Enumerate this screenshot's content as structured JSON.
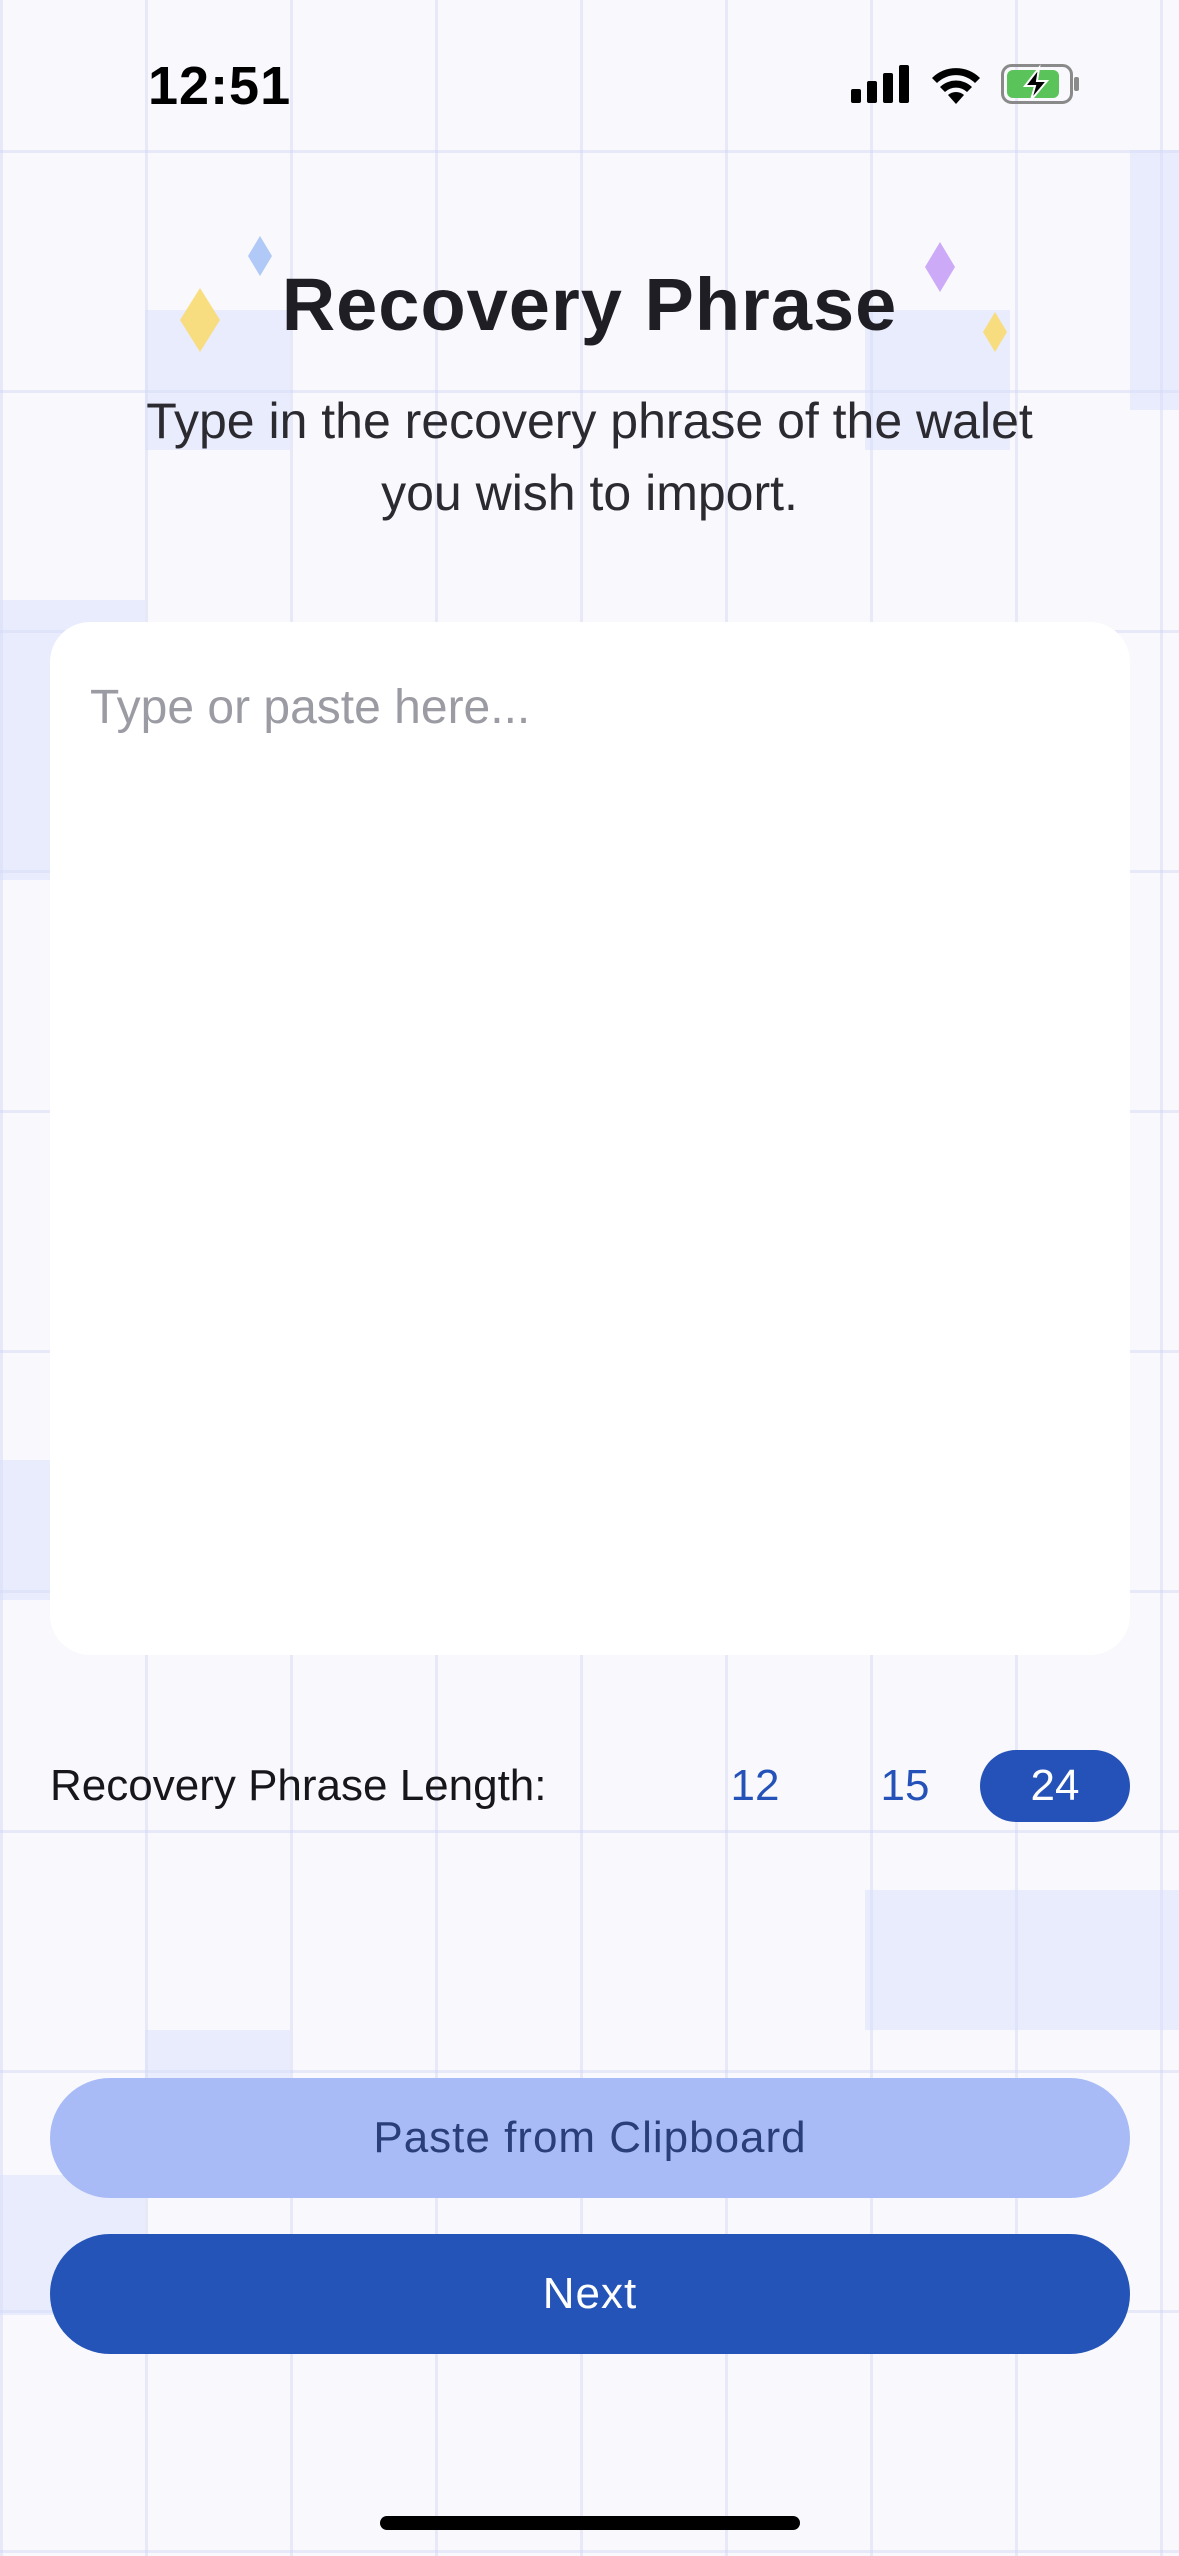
{
  "status_bar": {
    "time": "12:51",
    "icons": [
      "cellular-signal-icon",
      "wifi-icon",
      "battery-charging-icon"
    ]
  },
  "header": {
    "title": "Recovery Phrase",
    "subtitle": "Type in the recovery phrase of the walet you wish to import."
  },
  "phrase_input": {
    "value": "",
    "placeholder": "Type or paste here..."
  },
  "phrase_length": {
    "label": "Recovery Phrase Length:",
    "options": [
      "12",
      "15",
      "24"
    ],
    "selected": "24"
  },
  "actions": {
    "paste_label": "Paste from Clipboard",
    "next_label": "Next"
  },
  "colors": {
    "accent": "#2454b7",
    "accent_light": "#a8bbf7",
    "background": "#f8f8fd",
    "sparkle_yellow": "#f9d96a",
    "sparkle_purple": "#c6a1f7",
    "sparkle_blue": "#a9c3f5"
  }
}
